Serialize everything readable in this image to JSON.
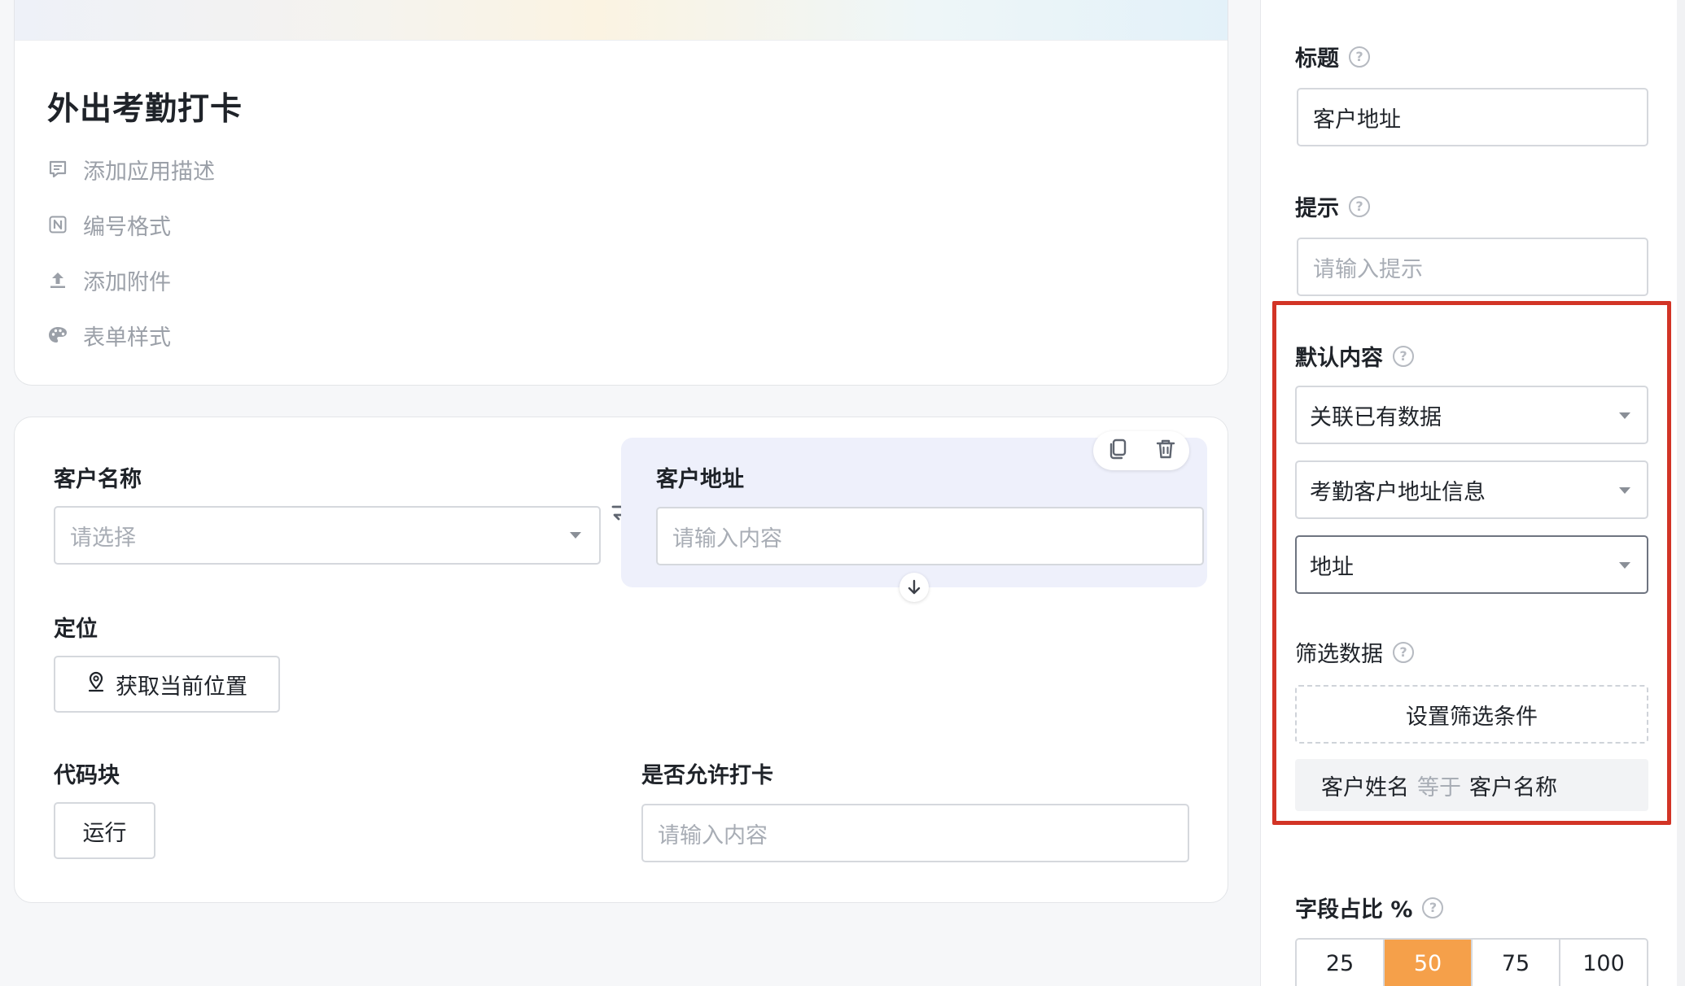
{
  "app": {
    "title": "外出考勤打卡",
    "meta_links": [
      {
        "icon": "comment-icon",
        "label": "添加应用描述"
      },
      {
        "icon": "numbering-icon",
        "label": "编号格式"
      },
      {
        "icon": "upload-icon",
        "label": "添加附件"
      },
      {
        "icon": "palette-icon",
        "label": "表单样式"
      }
    ]
  },
  "form": {
    "customer_name": {
      "label": "客户名称",
      "placeholder": "请选择"
    },
    "customer_address": {
      "label": "客户地址",
      "placeholder": "请输入内容"
    },
    "location": {
      "label": "定位",
      "button": "获取当前位置"
    },
    "code_block": {
      "label": "代码块",
      "button": "运行"
    },
    "allow_checkin": {
      "label": "是否允许打卡",
      "placeholder": "请输入内容"
    }
  },
  "panel": {
    "title_label": "标题",
    "title_value": "客户地址",
    "hint_label": "提示",
    "hint_placeholder": "请输入提示",
    "default_label": "默认内容",
    "default_mode": "关联已有数据",
    "default_source": "考勤客户地址信息",
    "default_field": "地址",
    "filter_label": "筛选数据",
    "filter_button": "设置筛选条件",
    "condition": {
      "left": "客户姓名",
      "op": "等于",
      "right": "客户名称"
    },
    "ratio_label": "字段占比 %",
    "ratio_options": [
      "25",
      "50",
      "75",
      "100"
    ],
    "ratio_selected": "50"
  },
  "colors": {
    "accent": "#f5a04a",
    "highlight": "#d23426",
    "selected_field_bg": "#eef0fb"
  }
}
